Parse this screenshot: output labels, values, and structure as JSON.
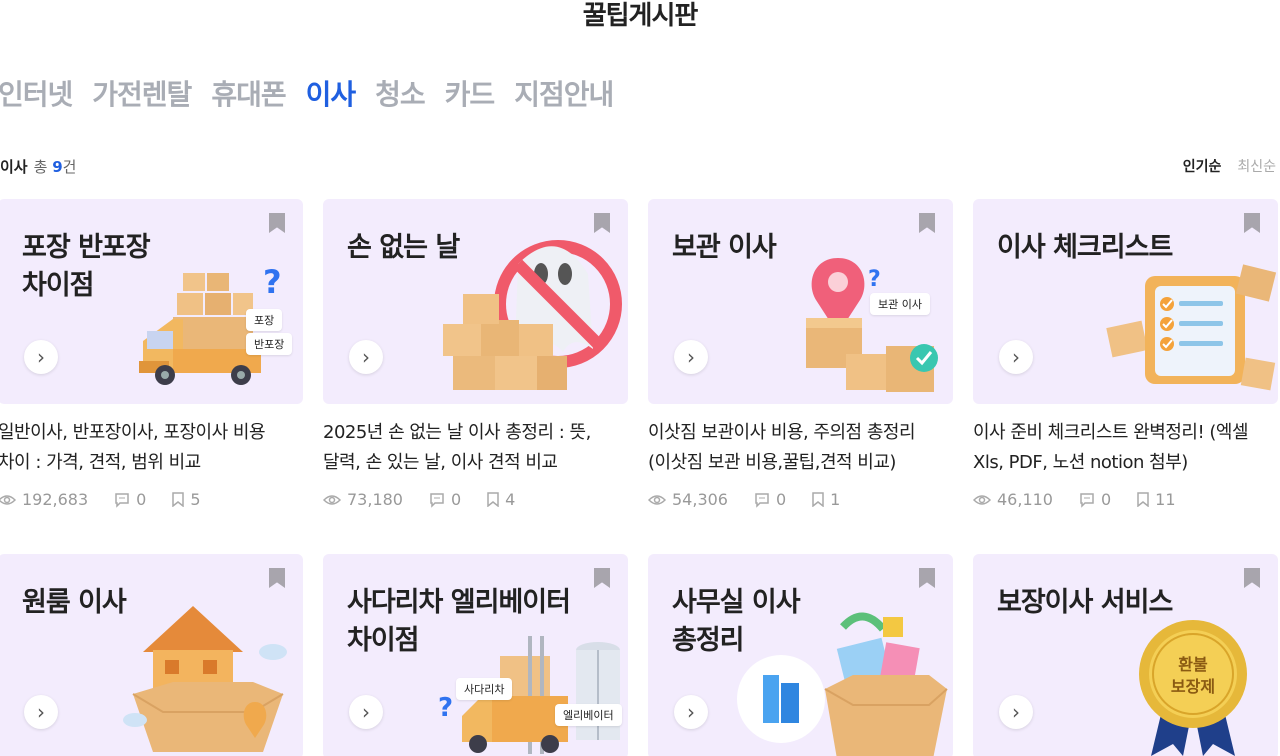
{
  "page": {
    "title": "꿀팁게시판"
  },
  "tabs": [
    {
      "label": "인터넷",
      "active": false
    },
    {
      "label": "가전렌탈",
      "active": false
    },
    {
      "label": "휴대폰",
      "active": false
    },
    {
      "label": "이사",
      "active": true
    },
    {
      "label": "청소",
      "active": false
    },
    {
      "label": "카드",
      "active": false
    },
    {
      "label": "지점안내",
      "active": false
    }
  ],
  "list": {
    "category": "이사",
    "total_prefix": "총",
    "total_count": "9",
    "total_suffix": "건"
  },
  "sort": {
    "popular": "인기순",
    "latest": "최신순"
  },
  "colors": {
    "accent": "#1f5fe0",
    "card_bg": "#f3ecfd",
    "muted": "#a9adb5"
  },
  "cards": [
    {
      "thumb_title": "포장 반포장\n차이점",
      "desc": "일반이사, 반포장이사, 포장이사 비용\n차이 : 가격, 견적, 범위 비교",
      "views": "192,683",
      "comments": "0",
      "bookmarks": "5",
      "chips": [
        "포장",
        "반포장"
      ],
      "illustration": "truck-boxes-question"
    },
    {
      "thumb_title": "손 없는 날",
      "desc": "2025년 손 없는 날 이사 총정리 : 뜻,\n달력, 손 있는 날, 이사 견적 비교",
      "views": "73,180",
      "comments": "0",
      "bookmarks": "4",
      "chips": [],
      "illustration": "ghost-no-sign-boxes"
    },
    {
      "thumb_title": "보관 이사",
      "desc": "이삿짐 보관이사 비용, 주의점 총정리\n(이삿짐 보관 비용,꿀팁,견적 비교)",
      "views": "54,306",
      "comments": "0",
      "bookmarks": "1",
      "chips": [
        "보관 이사"
      ],
      "illustration": "pin-boxes-check"
    },
    {
      "thumb_title": "이사 체크리스트",
      "desc": "이사 준비 체크리스트 완벽정리! (엑셀\nXls, PDF, 노션 notion 첨부)",
      "views": "46,110",
      "comments": "0",
      "bookmarks": "11",
      "chips": [],
      "illustration": "checklist-board"
    },
    {
      "thumb_title": "원룸 이사",
      "illustration": "house-box-pin"
    },
    {
      "thumb_title": "사다리차 엘리베이터\n차이점",
      "chips": [
        "사다리차",
        "엘리베이터"
      ],
      "illustration": "truck-ladder-elevator"
    },
    {
      "thumb_title": "사무실 이사\n총정리",
      "illustration": "office-box-building"
    },
    {
      "thumb_title": "보장이사 서비스",
      "badge": [
        "환불",
        "보장제"
      ],
      "illustration": "gold-medal"
    }
  ]
}
